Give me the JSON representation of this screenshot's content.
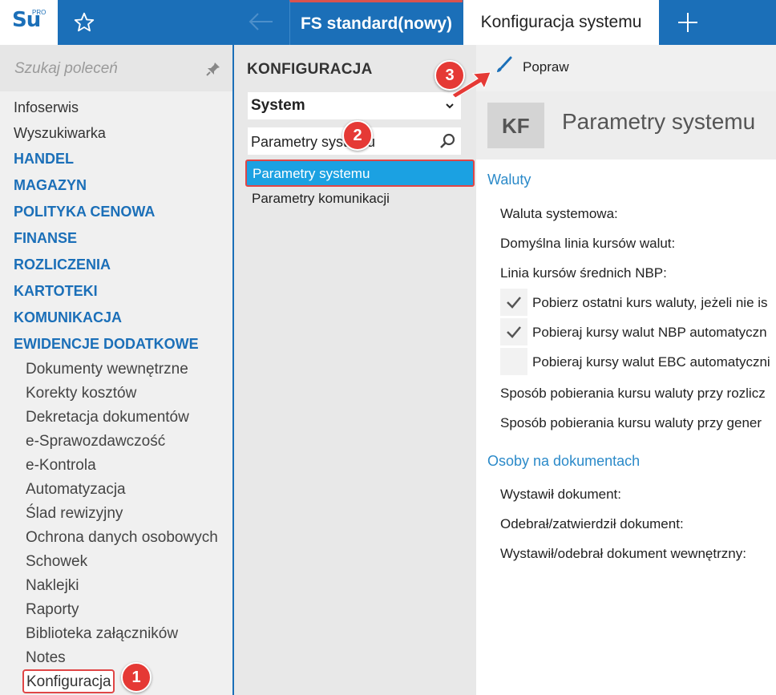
{
  "app": {
    "logo_text": "Su",
    "logo_superscript": "PRO",
    "icons": {
      "favorite": "star-icon",
      "back": "arrow-left-icon",
      "new_tab": "plus-icon"
    }
  },
  "tabs": [
    {
      "label": "FS standard(nowy)"
    },
    {
      "label": "Konfiguracja systemu"
    }
  ],
  "sidebar": {
    "search_placeholder": "Szukaj poleceń",
    "top_items": [
      "Infoserwis",
      "Wyszukiwarka"
    ],
    "sections": [
      "HANDEL",
      "MAGAZYN",
      "POLITYKA CENOWA",
      "FINANSE",
      "ROZLICZENIA",
      "KARTOTEKI",
      "KOMUNIKACJA",
      "EWIDENCJE DODATKOWE"
    ],
    "sub_items": [
      "Dokumenty wewnętrzne",
      "Korekty kosztów",
      "Dekretacja dokumentów",
      "e-Sprawozdawczość",
      "e-Kontrola",
      "Automatyzacja",
      "Ślad rewizyjny",
      "Ochrona danych osobowych",
      "Schowek",
      "Naklejki",
      "Raporty",
      "Biblioteka załączników",
      "Notes"
    ],
    "active_item": "Konfiguracja"
  },
  "config_panel": {
    "title": "KONFIGURACJA",
    "selected_group": "System",
    "search_value": "Parametry systemu",
    "items": [
      "Parametry systemu",
      "Parametry komunikacji"
    ]
  },
  "content": {
    "toolbar_action": "Popraw",
    "badge": "KF",
    "title": "Parametry systemu",
    "sections": [
      {
        "heading": "Waluty",
        "fields": [
          "Waluta systemowa:",
          "Domyślna linia kursów walut:",
          "Linia kursów średnich NBP:"
        ],
        "checkboxes": [
          {
            "label": "Pobierz ostatni kurs waluty, jeżeli nie is",
            "checked": true
          },
          {
            "label": "Pobieraj kursy walut NBP automatyczn",
            "checked": true
          },
          {
            "label": "Pobieraj kursy walut EBC automatyczni",
            "checked": false
          }
        ],
        "extra_fields": [
          "Sposób pobierania kursu waluty przy rozlicz",
          "Sposób pobierania kursu waluty przy gener"
        ]
      },
      {
        "heading": "Osoby na dokumentach",
        "fields": [
          "Wystawił dokument:",
          "Odebrał/zatwierdził dokument:",
          "Wystawił/odebrał dokument wewnętrzny:"
        ]
      }
    ]
  },
  "callouts": [
    "1",
    "2",
    "3"
  ],
  "colors": {
    "primary": "#1b6fb8",
    "accent": "#1ba1e2",
    "callout": "#e53935"
  }
}
